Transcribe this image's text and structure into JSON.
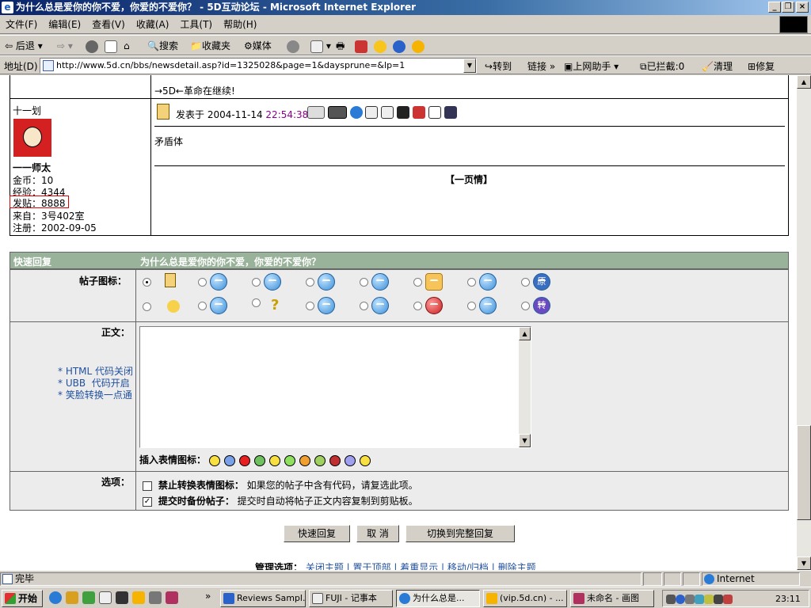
{
  "window": {
    "title": "为什么总是爱你的你不爱，你爱的不爱你？ - 5D互动论坛 - Microsoft Internet Explorer"
  },
  "menu": [
    "文件(F)",
    "编辑(E)",
    "查看(V)",
    "收藏(A)",
    "工具(T)",
    "帮助(H)"
  ],
  "toolbar": {
    "back": "后退",
    "search": "搜索",
    "favorites": "收藏夹",
    "media": "媒体"
  },
  "address": {
    "label": "地址(D)",
    "url": "http://www.5d.cn/bbs/newsdetail.asp?id=1325028&page=1&daysprune=&lp=1",
    "go": "转到",
    "links": "链接",
    "helper": "上网助手",
    "blocked": "已拦截:0",
    "clean": "清理",
    "repair": "修复"
  },
  "post": {
    "prev_signature": "→5D←革命在继续!",
    "author_title": "十一划",
    "author_name": "一一师太",
    "stats": [
      "金币：10",
      "经验：4344",
      "发贴：8888",
      "来自：3号402室",
      "注册：2002-09-05"
    ],
    "posted_label": "发表于",
    "posted_date": "2004-11-14",
    "posted_time": "22:54:38",
    "body": "矛盾体",
    "signature": "【一页情】"
  },
  "reply": {
    "header_left": "快速回复",
    "header_title": "为什么总是爱你的你不爱，你爱的不爱你？",
    "icon_label": "帖子图标：",
    "body_label": "正文：",
    "notes": [
      "* HTML 代码关闭",
      "* UBB  代码开启",
      "* 笑脸转换一点通"
    ],
    "emote_label": "插入表情图标：",
    "options_label": "选项：",
    "opt1_bold": "禁止转换表情图标：",
    "opt1_text": "如果您的帖子中含有代码，请复选此项。",
    "opt2_bold": "提交时备份帖子：",
    "opt2_text": "提交时自动将帖子正文内容复制到剪贴板。",
    "btn_quick": "快速回复",
    "btn_cancel": "取 消",
    "btn_full": "切换到完整回复",
    "admin_label": "管理选项：",
    "admin_links": "关闭主题 | 置于顶部 | 着重显示 | 移动/归档 | 删除主题",
    "icon_badge_yuan": "原",
    "icon_badge_zhuan": "转"
  },
  "status": {
    "text": "完毕",
    "zone": "Internet"
  },
  "taskbar": {
    "start": "开始",
    "tasks": [
      "Reviews Sampl...",
      "FUJI - 记事本",
      "为什么总是...",
      "(vip.5d.cn) - ...",
      "未命名 - 画图"
    ],
    "clock": "23:11"
  },
  "colors": {
    "header_green": "#99b39a",
    "row_bg": "#ececec",
    "time_purple": "#8b008b"
  }
}
